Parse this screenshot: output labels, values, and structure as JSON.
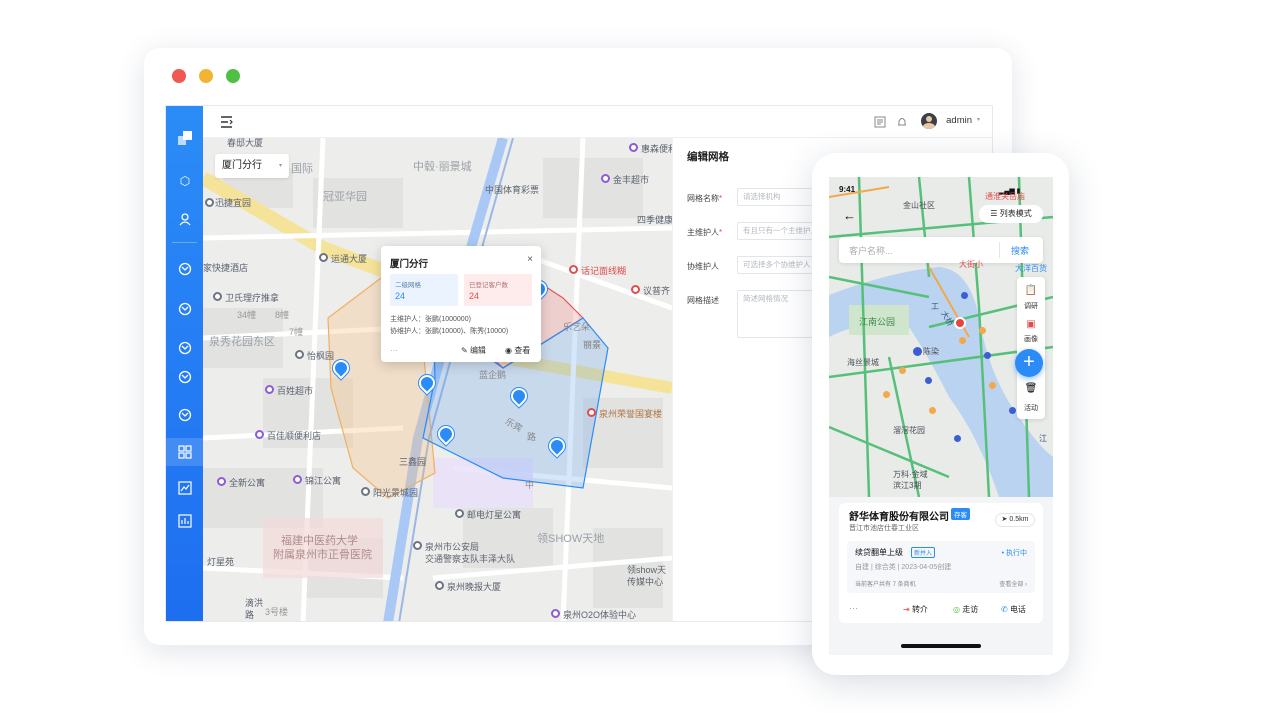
{
  "desktop": {
    "topbar": {
      "username": "admin"
    },
    "map": {
      "branch_select": "厦门分行",
      "labels": {
        "l1": "春邸大厦",
        "l2": "国际",
        "l3": "中毂·丽景城",
        "l4": "冠亚华园",
        "l5": "中国体育彩票",
        "l6": "迅捷宜园",
        "l7": "四季健康",
        "l8": "惠森便利",
        "l9": "金丰超市",
        "l10": "运通大厦",
        "l11": "家快捷酒店",
        "l12": "卫氏理疗推拿",
        "l13": "34幢",
        "l14": "8幢",
        "l15": "7幢",
        "l16": "泉秀花园东区",
        "l17": "怡枫园",
        "l18": "百姓超市",
        "l19": "百佳顺便利店",
        "l20": "全新公寓",
        "l21": "锦江公寓",
        "l22": "阳光景城园",
        "l23": "三鑫园",
        "l24": "福建中医药大学",
        "l25": "附属泉州市正骨医院",
        "l26": "灯星苑",
        "l27": "邮电灯星公寓",
        "l28": "泉州市公安局",
        "l29": "交通警察支队丰泽大队",
        "l30": "泉州晚报大厦",
        "l31": "领SHOW天地",
        "l32": "领show天",
        "l33": "传媒中心",
        "l34": "泉州O2O体验中心",
        "l35": "3号楼",
        "l36": "滴洪",
        "l37": "路",
        "l38": "话记面线糊",
        "l39": "议普齐",
        "l40": "乐艺朵",
        "l41": "泉州荣誉国宴楼",
        "l42": "蓝企鹅",
        "l43": "乐宾",
        "l44": "路",
        "l45": "中",
        "l46": "丽景",
        "l47": "新悦城",
        "l48": "泉州",
        "l49": "佰悦城",
        "l50": "福建",
        "l51": "晋江公园"
      },
      "popup": {
        "title": "厦门分行",
        "stat1_label": "二级网格",
        "stat1_value": "24",
        "stat2_label": "已登记客户数",
        "stat2_value": "24",
        "main_keeper_label": "主维护人：",
        "main_keeper_value": "张鹏(1000000)",
        "co_keeper_label": "协维护人：",
        "co_keeper_value": "张鹏(10000)、陈秀(10000)",
        "more": "···",
        "edit": "编辑",
        "view": "查看"
      }
    },
    "panel": {
      "title": "编辑网格",
      "grid_name_label": "网格名称",
      "grid_name_placeholder": "请选择机构",
      "main_keeper_label": "主维护人",
      "main_keeper_placeholder": "有且只有一个主维护人",
      "co_keeper_label": "协维护人",
      "co_keeper_placeholder": "可选择多个协维护人",
      "desc_label": "网格描述",
      "desc_placeholder": "简述网格情况"
    }
  },
  "phone": {
    "status_time": "9:41",
    "top_label": "通淮关岳庙",
    "list_mode": "列表模式",
    "search_placeholder": "客户名称...",
    "search_button": "搜索",
    "map_labels": {
      "m1": "金山社区",
      "m2": "大洋百货",
      "m3": "江南公园",
      "m4": "海丝景城",
      "m5": "陈染",
      "m6": "万科·金域",
      "m7": "滨江3期",
      "m8": "溜滘花园",
      "m9": "工",
      "m10": "江",
      "m11": "大街小",
      "m12": "大桥"
    },
    "tools": [
      "调研",
      "画像",
      "活动"
    ],
    "card": {
      "company": "舒华体育股份有限公司",
      "tag": "存客",
      "address": "晋江市池店仕春工业区",
      "distance": "0.5km",
      "task_title": "续贷翻单上级",
      "task_tag": "新并入",
      "task_status": "执行中",
      "task_meta": "自建 | 综合类 | 2023-04-05创建",
      "summary": "当前客户共有 7 条商机",
      "view_all": "查看全部",
      "more": "···",
      "action1": "转介",
      "action2": "走访",
      "action3": "电话"
    }
  }
}
